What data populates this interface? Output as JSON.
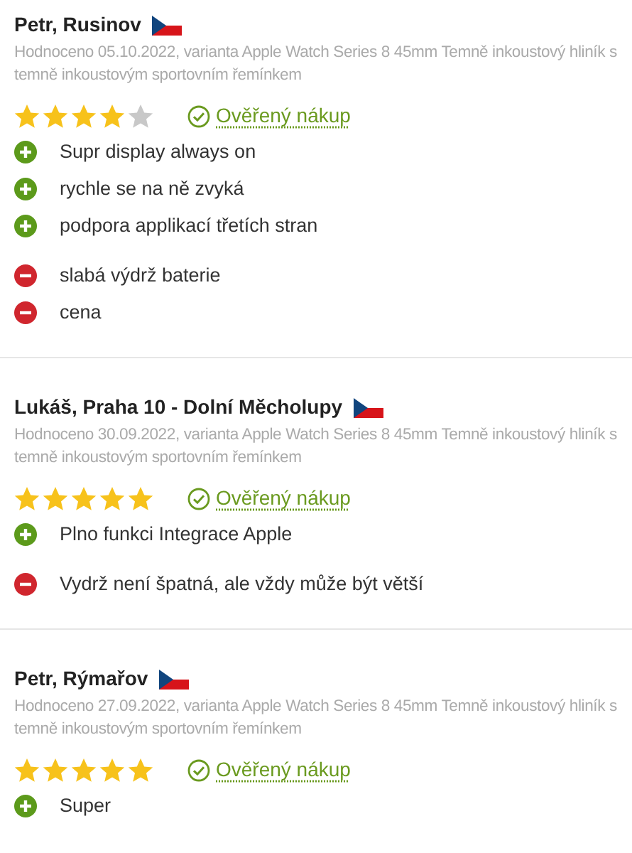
{
  "reviews": [
    {
      "author": "Petr, Rusinov",
      "meta": "Hodnoceno 05.10.2022, varianta Apple Watch Series 8 45mm Temně inkoustový hliník s temně inkoustovým sportovním řemínkem",
      "stars": 4,
      "verified": "Ověřený nákup",
      "points": [
        {
          "kind": "pro",
          "text": "Supr display always on"
        },
        {
          "kind": "pro",
          "text": "rychle se na ně zvyká"
        },
        {
          "kind": "pro",
          "text": "podpora applikací třetích stran"
        },
        {
          "kind": "con",
          "text": "slabá výdrž baterie"
        },
        {
          "kind": "con",
          "text": "cena"
        }
      ]
    },
    {
      "author": "Lukáš, Praha 10 - Dolní Měcholupy",
      "meta": "Hodnoceno 30.09.2022, varianta Apple Watch Series 8 45mm Temně inkoustový hliník s temně inkoustovým sportovním řemínkem",
      "stars": 5,
      "verified": "Ověřený nákup",
      "points": [
        {
          "kind": "pro",
          "text": "Plno funkci Integrace Apple"
        },
        {
          "kind": "con",
          "text": "Vydrž není špatná, ale vždy může být větší"
        }
      ]
    },
    {
      "author": "Petr, Rýmařov",
      "meta": "Hodnoceno 27.09.2022, varianta Apple Watch Series 8 45mm Temně inkoustový hliník s temně inkoustovým sportovním řemínkem",
      "stars": 5,
      "verified": "Ověřený nákup",
      "points": [
        {
          "kind": "pro",
          "text": "Super"
        }
      ]
    }
  ]
}
